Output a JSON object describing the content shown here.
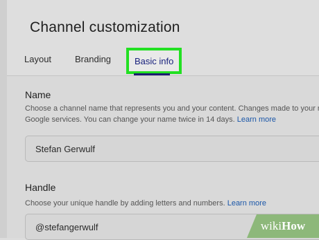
{
  "header": {
    "title": "Channel customization",
    "tabs": [
      {
        "label": "Layout"
      },
      {
        "label": "Branding"
      },
      {
        "label": "Basic info"
      }
    ],
    "active_tab": "Basic info"
  },
  "name_section": {
    "label": "Name",
    "description_line1": "Choose a channel name that represents you and your content. Changes made to your na",
    "description_line2": "Google services. You can change your name twice in 14 days.",
    "learn_more": "Learn more",
    "value": "Stefan Gerwulf"
  },
  "handle_section": {
    "label": "Handle",
    "description": "Choose your unique handle by adding letters and numbers.",
    "learn_more": "Learn more",
    "value": "@stefangerwulf"
  },
  "watermark": {
    "wiki": "wiki",
    "how": "How"
  },
  "colors": {
    "highlight": "#22e022",
    "active_tab_text": "#1a237e",
    "link": "#1a56a8",
    "watermark_bg": "#8db87a"
  }
}
